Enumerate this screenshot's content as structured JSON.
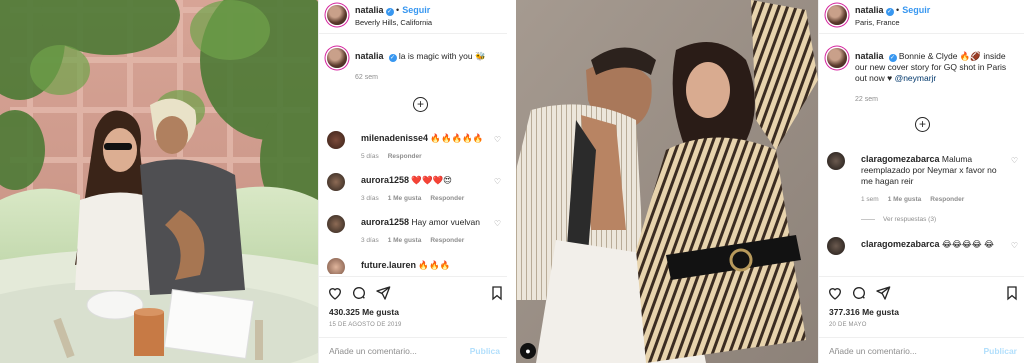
{
  "colors": {
    "link": "#3897f0",
    "muted": "#8e8e8e",
    "text": "#262626",
    "border": "#efefef"
  },
  "post1": {
    "user": "natalia",
    "verified": "✓",
    "follow": "Seguir",
    "location": "Beverly Hills, California",
    "caption": "la is magic with you 🐝",
    "caption_time": "62 sem",
    "comments": [
      {
        "user": "milenadenisse4",
        "text": "🔥🔥🔥🔥🔥",
        "time": "5 días",
        "likes": "",
        "reply": "Responder"
      },
      {
        "user": "aurora1258",
        "text": "❤️❤️❤️😍",
        "time": "3 días",
        "likes": "1 Me gusta",
        "reply": "Responder"
      },
      {
        "user": "aurora1258",
        "text": "Hay amor vuelvan",
        "time": "3 días",
        "likes": "1 Me gusta",
        "reply": "Responder"
      },
      {
        "user": "future.lauren",
        "text": "🔥🔥🔥",
        "time": "",
        "likes": "",
        "reply": ""
      }
    ],
    "likes": "430.325 Me gusta",
    "date": "15 DE AGOSTO DE 2019",
    "add_comment": "Añade un comentario...",
    "publish": "Publica"
  },
  "post2": {
    "user": "natalia",
    "verified": "✓",
    "follow": "Seguir",
    "location": "Paris, France",
    "caption_parts": {
      "text": "Bonnie & Clyde 🔥🏈 inside our new cover story for GQ shot in Paris out now ♥",
      "mention": "@neymarjr"
    },
    "caption_time": "22 sem",
    "comments": [
      {
        "user": "claragomezabarca",
        "text": "Maluma reemplazado por Neymar x favor no me hagan reir",
        "time": "1 sem",
        "likes": "1 Me gusta",
        "reply": "Responder"
      },
      {
        "user": "claragomezabarca",
        "text": "😂😂😂😂 😂",
        "time": "",
        "likes": "",
        "reply": ""
      }
    ],
    "view_replies": "Ver respuestas (3)",
    "likes": "377.316 Me gusta",
    "date": "20 DE MAYO",
    "add_comment": "Añade un comentario...",
    "publish": "Publicar"
  },
  "icons": [
    "heart-icon",
    "comment-icon",
    "share-icon",
    "bookmark-icon",
    "add-icon"
  ]
}
